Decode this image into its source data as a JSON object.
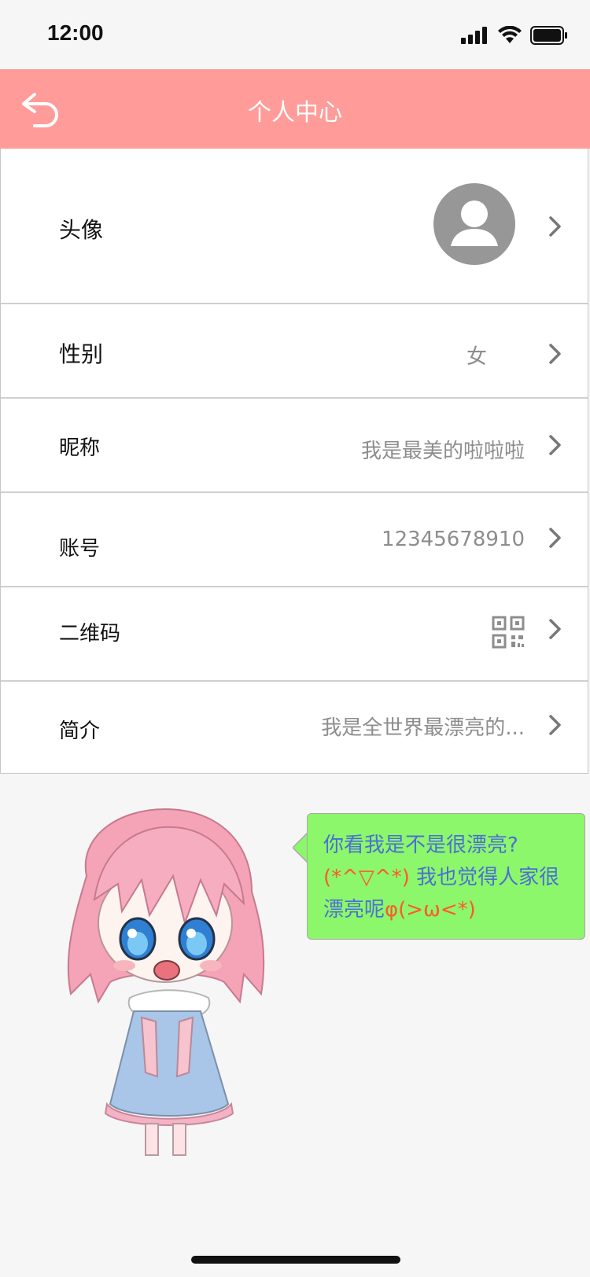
{
  "status": {
    "time": "12:00",
    "signal_icon": "signal-icon",
    "wifi_icon": "wifi-icon",
    "battery_icon": "battery-icon"
  },
  "navbar": {
    "title": "个人中心",
    "back_icon": "back-arrow-icon",
    "bg_color": "#ff9c99"
  },
  "profile": {
    "avatar_label": "头像",
    "gender_label": "性别",
    "gender_value": "女",
    "nickname_label": "昵称",
    "nickname_value": "我是最美的啦啦啦",
    "account_label": "账号",
    "account_value": "12345678910",
    "qrcode_label": "二维码",
    "qrcode_icon": "qr-code-icon",
    "bio_label": "简介",
    "bio_value": "我是全世界最漂亮的..."
  },
  "speech": {
    "line1": "你看我是不是很漂亮?",
    "emoticon1": "(*^▽^*)",
    "line2": " 我也觉得人家很",
    "line3": "漂亮呢",
    "emoticon2": "φ(>ω<*)",
    "bg_color": "#8cf76a"
  }
}
